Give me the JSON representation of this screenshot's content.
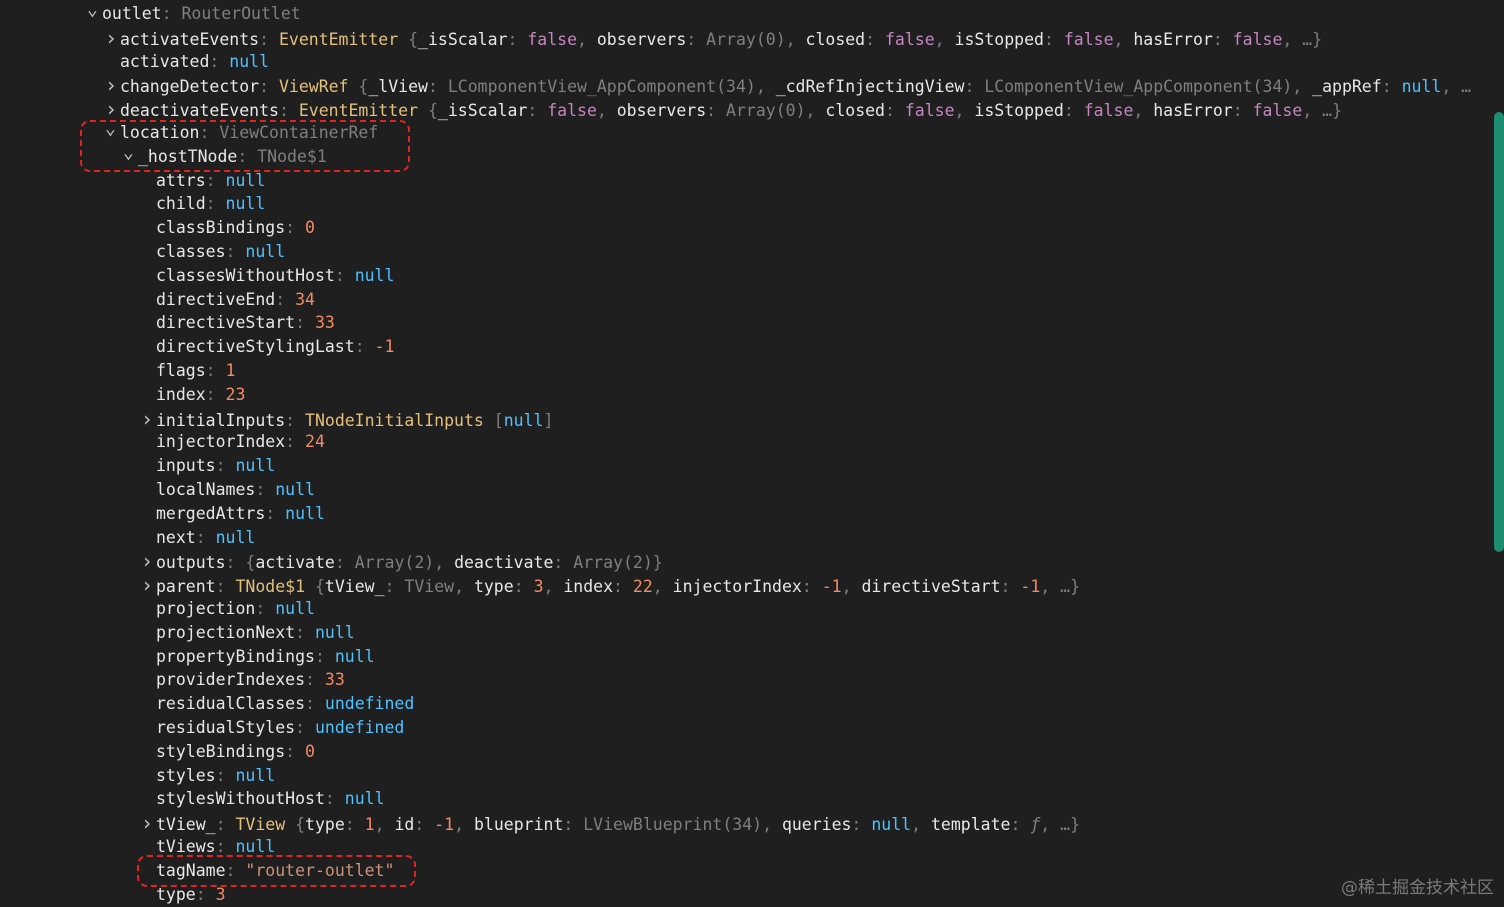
{
  "colors": {
    "background": "#1f1f1f",
    "key": "#e8e8e8",
    "class": "#e5c07b",
    "bool": "#c586c0",
    "null": "#4fc1ff",
    "number": "#f08b64",
    "string": "#ce9178",
    "highlight": "#e32222",
    "scrollbar": "#1e8e73"
  },
  "icons": {
    "expanded": "chevron-down-icon",
    "collapsed": "chevron-right-icon"
  },
  "tree": [
    {
      "indent": 0,
      "toggle": "expanded",
      "key": "outlet",
      "parts": [
        {
          "t": "type-dim",
          "v": "RouterOutlet"
        }
      ]
    },
    {
      "indent": 1,
      "toggle": "collapsed",
      "key": "activateEvents",
      "parts": [
        {
          "t": "t-class",
          "v": "EventEmitter"
        },
        {
          "t": "punc",
          "v": " {"
        },
        {
          "t": "key",
          "v": "_isScalar"
        },
        {
          "t": "punc",
          "v": ": "
        },
        {
          "t": "t-bool",
          "v": "false"
        },
        {
          "t": "punc",
          "v": ", "
        },
        {
          "t": "key",
          "v": "observers"
        },
        {
          "t": "punc",
          "v": ": "
        },
        {
          "t": "type-dim",
          "v": "Array(0)"
        },
        {
          "t": "punc",
          "v": ", "
        },
        {
          "t": "key",
          "v": "closed"
        },
        {
          "t": "punc",
          "v": ": "
        },
        {
          "t": "t-bool",
          "v": "false"
        },
        {
          "t": "punc",
          "v": ", "
        },
        {
          "t": "key",
          "v": "isStopped"
        },
        {
          "t": "punc",
          "v": ": "
        },
        {
          "t": "t-bool",
          "v": "false"
        },
        {
          "t": "punc",
          "v": ", "
        },
        {
          "t": "key",
          "v": "hasError"
        },
        {
          "t": "punc",
          "v": ": "
        },
        {
          "t": "t-bool",
          "v": "false"
        },
        {
          "t": "punc",
          "v": ", …}"
        }
      ]
    },
    {
      "indent": 1,
      "toggle": "none",
      "key": "activated",
      "parts": [
        {
          "t": "t-null",
          "v": "null"
        }
      ]
    },
    {
      "indent": 1,
      "toggle": "collapsed",
      "key": "changeDetector",
      "parts": [
        {
          "t": "t-class",
          "v": "ViewRef"
        },
        {
          "t": "punc",
          "v": " {"
        },
        {
          "t": "key",
          "v": "_lView"
        },
        {
          "t": "punc",
          "v": ": "
        },
        {
          "t": "type-dim",
          "v": "LComponentView_AppComponent(34)"
        },
        {
          "t": "punc",
          "v": ", "
        },
        {
          "t": "key",
          "v": "_cdRefInjectingView"
        },
        {
          "t": "punc",
          "v": ": "
        },
        {
          "t": "type-dim",
          "v": "LComponentView_AppComponent(34)"
        },
        {
          "t": "punc",
          "v": ", "
        },
        {
          "t": "key",
          "v": "_appRef"
        },
        {
          "t": "punc",
          "v": ": "
        },
        {
          "t": "t-null",
          "v": "null"
        },
        {
          "t": "punc",
          "v": ", …"
        }
      ]
    },
    {
      "indent": 1,
      "toggle": "collapsed",
      "key": "deactivateEvents",
      "parts": [
        {
          "t": "t-class",
          "v": "EventEmitter"
        },
        {
          "t": "punc",
          "v": " {"
        },
        {
          "t": "key",
          "v": "_isScalar"
        },
        {
          "t": "punc",
          "v": ": "
        },
        {
          "t": "t-bool",
          "v": "false"
        },
        {
          "t": "punc",
          "v": ", "
        },
        {
          "t": "key",
          "v": "observers"
        },
        {
          "t": "punc",
          "v": ": "
        },
        {
          "t": "type-dim",
          "v": "Array(0)"
        },
        {
          "t": "punc",
          "v": ", "
        },
        {
          "t": "key",
          "v": "closed"
        },
        {
          "t": "punc",
          "v": ": "
        },
        {
          "t": "t-bool",
          "v": "false"
        },
        {
          "t": "punc",
          "v": ", "
        },
        {
          "t": "key",
          "v": "isStopped"
        },
        {
          "t": "punc",
          "v": ": "
        },
        {
          "t": "t-bool",
          "v": "false"
        },
        {
          "t": "punc",
          "v": ", "
        },
        {
          "t": "key",
          "v": "hasError"
        },
        {
          "t": "punc",
          "v": ": "
        },
        {
          "t": "t-bool",
          "v": "false"
        },
        {
          "t": "punc",
          "v": ", …}"
        }
      ]
    },
    {
      "indent": 1,
      "toggle": "expanded",
      "key": "location",
      "parts": [
        {
          "t": "type-dim",
          "v": "ViewContainerRef"
        }
      ]
    },
    {
      "indent": 2,
      "toggle": "expanded",
      "key": "_hostTNode",
      "parts": [
        {
          "t": "type-dim",
          "v": "TNode$1"
        }
      ]
    },
    {
      "indent": 3,
      "toggle": "none",
      "key": "attrs",
      "parts": [
        {
          "t": "t-null",
          "v": "null"
        }
      ]
    },
    {
      "indent": 3,
      "toggle": "none",
      "key": "child",
      "parts": [
        {
          "t": "t-null",
          "v": "null"
        }
      ]
    },
    {
      "indent": 3,
      "toggle": "none",
      "key": "classBindings",
      "parts": [
        {
          "t": "t-num",
          "v": "0"
        }
      ]
    },
    {
      "indent": 3,
      "toggle": "none",
      "key": "classes",
      "parts": [
        {
          "t": "t-null",
          "v": "null"
        }
      ]
    },
    {
      "indent": 3,
      "toggle": "none",
      "key": "classesWithoutHost",
      "parts": [
        {
          "t": "t-null",
          "v": "null"
        }
      ]
    },
    {
      "indent": 3,
      "toggle": "none",
      "key": "directiveEnd",
      "parts": [
        {
          "t": "t-num",
          "v": "34"
        }
      ]
    },
    {
      "indent": 3,
      "toggle": "none",
      "key": "directiveStart",
      "parts": [
        {
          "t": "t-num",
          "v": "33"
        }
      ]
    },
    {
      "indent": 3,
      "toggle": "none",
      "key": "directiveStylingLast",
      "parts": [
        {
          "t": "t-num",
          "v": "-1"
        }
      ]
    },
    {
      "indent": 3,
      "toggle": "none",
      "key": "flags",
      "parts": [
        {
          "t": "t-num",
          "v": "1"
        }
      ]
    },
    {
      "indent": 3,
      "toggle": "none",
      "key": "index",
      "parts": [
        {
          "t": "t-num",
          "v": "23"
        }
      ]
    },
    {
      "indent": 3,
      "toggle": "collapsed",
      "key": "initialInputs",
      "parts": [
        {
          "t": "t-class",
          "v": "TNodeInitialInputs"
        },
        {
          "t": "punc",
          "v": " ["
        },
        {
          "t": "t-null",
          "v": "null"
        },
        {
          "t": "punc",
          "v": "]"
        }
      ]
    },
    {
      "indent": 3,
      "toggle": "none",
      "key": "injectorIndex",
      "parts": [
        {
          "t": "t-num",
          "v": "24"
        }
      ]
    },
    {
      "indent": 3,
      "toggle": "none",
      "key": "inputs",
      "parts": [
        {
          "t": "t-null",
          "v": "null"
        }
      ]
    },
    {
      "indent": 3,
      "toggle": "none",
      "key": "localNames",
      "parts": [
        {
          "t": "t-null",
          "v": "null"
        }
      ]
    },
    {
      "indent": 3,
      "toggle": "none",
      "key": "mergedAttrs",
      "parts": [
        {
          "t": "t-null",
          "v": "null"
        }
      ]
    },
    {
      "indent": 3,
      "toggle": "none",
      "key": "next",
      "parts": [
        {
          "t": "t-null",
          "v": "null"
        }
      ]
    },
    {
      "indent": 3,
      "toggle": "collapsed",
      "key": "outputs",
      "parts": [
        {
          "t": "punc",
          "v": "{"
        },
        {
          "t": "key",
          "v": "activate"
        },
        {
          "t": "punc",
          "v": ": "
        },
        {
          "t": "type-dim",
          "v": "Array(2)"
        },
        {
          "t": "punc",
          "v": ", "
        },
        {
          "t": "key",
          "v": "deactivate"
        },
        {
          "t": "punc",
          "v": ": "
        },
        {
          "t": "type-dim",
          "v": "Array(2)"
        },
        {
          "t": "punc",
          "v": "}"
        }
      ]
    },
    {
      "indent": 3,
      "toggle": "collapsed",
      "key": "parent",
      "parts": [
        {
          "t": "t-class",
          "v": "TNode$1"
        },
        {
          "t": "punc",
          "v": " {"
        },
        {
          "t": "key",
          "v": "tView_"
        },
        {
          "t": "punc",
          "v": ": "
        },
        {
          "t": "type-dim",
          "v": "TView"
        },
        {
          "t": "punc",
          "v": ", "
        },
        {
          "t": "key",
          "v": "type"
        },
        {
          "t": "punc",
          "v": ": "
        },
        {
          "t": "t-num",
          "v": "3"
        },
        {
          "t": "punc",
          "v": ", "
        },
        {
          "t": "key",
          "v": "index"
        },
        {
          "t": "punc",
          "v": ": "
        },
        {
          "t": "t-num",
          "v": "22"
        },
        {
          "t": "punc",
          "v": ", "
        },
        {
          "t": "key",
          "v": "injectorIndex"
        },
        {
          "t": "punc",
          "v": ": "
        },
        {
          "t": "t-num",
          "v": "-1"
        },
        {
          "t": "punc",
          "v": ", "
        },
        {
          "t": "key",
          "v": "directiveStart"
        },
        {
          "t": "punc",
          "v": ": "
        },
        {
          "t": "t-num",
          "v": "-1"
        },
        {
          "t": "punc",
          "v": ", …}"
        }
      ]
    },
    {
      "indent": 3,
      "toggle": "none",
      "key": "projection",
      "parts": [
        {
          "t": "t-null",
          "v": "null"
        }
      ]
    },
    {
      "indent": 3,
      "toggle": "none",
      "key": "projectionNext",
      "parts": [
        {
          "t": "t-null",
          "v": "null"
        }
      ]
    },
    {
      "indent": 3,
      "toggle": "none",
      "key": "propertyBindings",
      "parts": [
        {
          "t": "t-null",
          "v": "null"
        }
      ]
    },
    {
      "indent": 3,
      "toggle": "none",
      "key": "providerIndexes",
      "parts": [
        {
          "t": "t-num",
          "v": "33"
        }
      ]
    },
    {
      "indent": 3,
      "toggle": "none",
      "key": "residualClasses",
      "parts": [
        {
          "t": "t-undef",
          "v": "undefined"
        }
      ]
    },
    {
      "indent": 3,
      "toggle": "none",
      "key": "residualStyles",
      "parts": [
        {
          "t": "t-undef",
          "v": "undefined"
        }
      ]
    },
    {
      "indent": 3,
      "toggle": "none",
      "key": "styleBindings",
      "parts": [
        {
          "t": "t-num",
          "v": "0"
        }
      ]
    },
    {
      "indent": 3,
      "toggle": "none",
      "key": "styles",
      "parts": [
        {
          "t": "t-null",
          "v": "null"
        }
      ]
    },
    {
      "indent": 3,
      "toggle": "none",
      "key": "stylesWithoutHost",
      "parts": [
        {
          "t": "t-null",
          "v": "null"
        }
      ]
    },
    {
      "indent": 3,
      "toggle": "collapsed",
      "key": "tView_",
      "parts": [
        {
          "t": "t-class",
          "v": "TView"
        },
        {
          "t": "punc",
          "v": " {"
        },
        {
          "t": "key",
          "v": "type"
        },
        {
          "t": "punc",
          "v": ": "
        },
        {
          "t": "t-num",
          "v": "1"
        },
        {
          "t": "punc",
          "v": ", "
        },
        {
          "t": "key",
          "v": "id"
        },
        {
          "t": "punc",
          "v": ": "
        },
        {
          "t": "t-num",
          "v": "-1"
        },
        {
          "t": "punc",
          "v": ", "
        },
        {
          "t": "key",
          "v": "blueprint"
        },
        {
          "t": "punc",
          "v": ": "
        },
        {
          "t": "type-dim",
          "v": "LViewBlueprint(34)"
        },
        {
          "t": "punc",
          "v": ", "
        },
        {
          "t": "key",
          "v": "queries"
        },
        {
          "t": "punc",
          "v": ": "
        },
        {
          "t": "t-null",
          "v": "null"
        },
        {
          "t": "punc",
          "v": ", "
        },
        {
          "t": "key",
          "v": "template"
        },
        {
          "t": "punc",
          "v": ": "
        },
        {
          "t": "t-fn",
          "v": "ƒ"
        },
        {
          "t": "punc",
          "v": ", …}"
        }
      ]
    },
    {
      "indent": 3,
      "toggle": "none",
      "key": "tViews",
      "parts": [
        {
          "t": "t-null",
          "v": "null"
        }
      ]
    },
    {
      "indent": 3,
      "toggle": "none",
      "key": "tagName",
      "parts": [
        {
          "t": "t-str",
          "v": "\"router-outlet\""
        }
      ]
    },
    {
      "indent": 3,
      "toggle": "none",
      "key": "type",
      "parts": [
        {
          "t": "t-num",
          "v": "3"
        }
      ]
    }
  ],
  "watermark": "@稀土掘金技术社区"
}
